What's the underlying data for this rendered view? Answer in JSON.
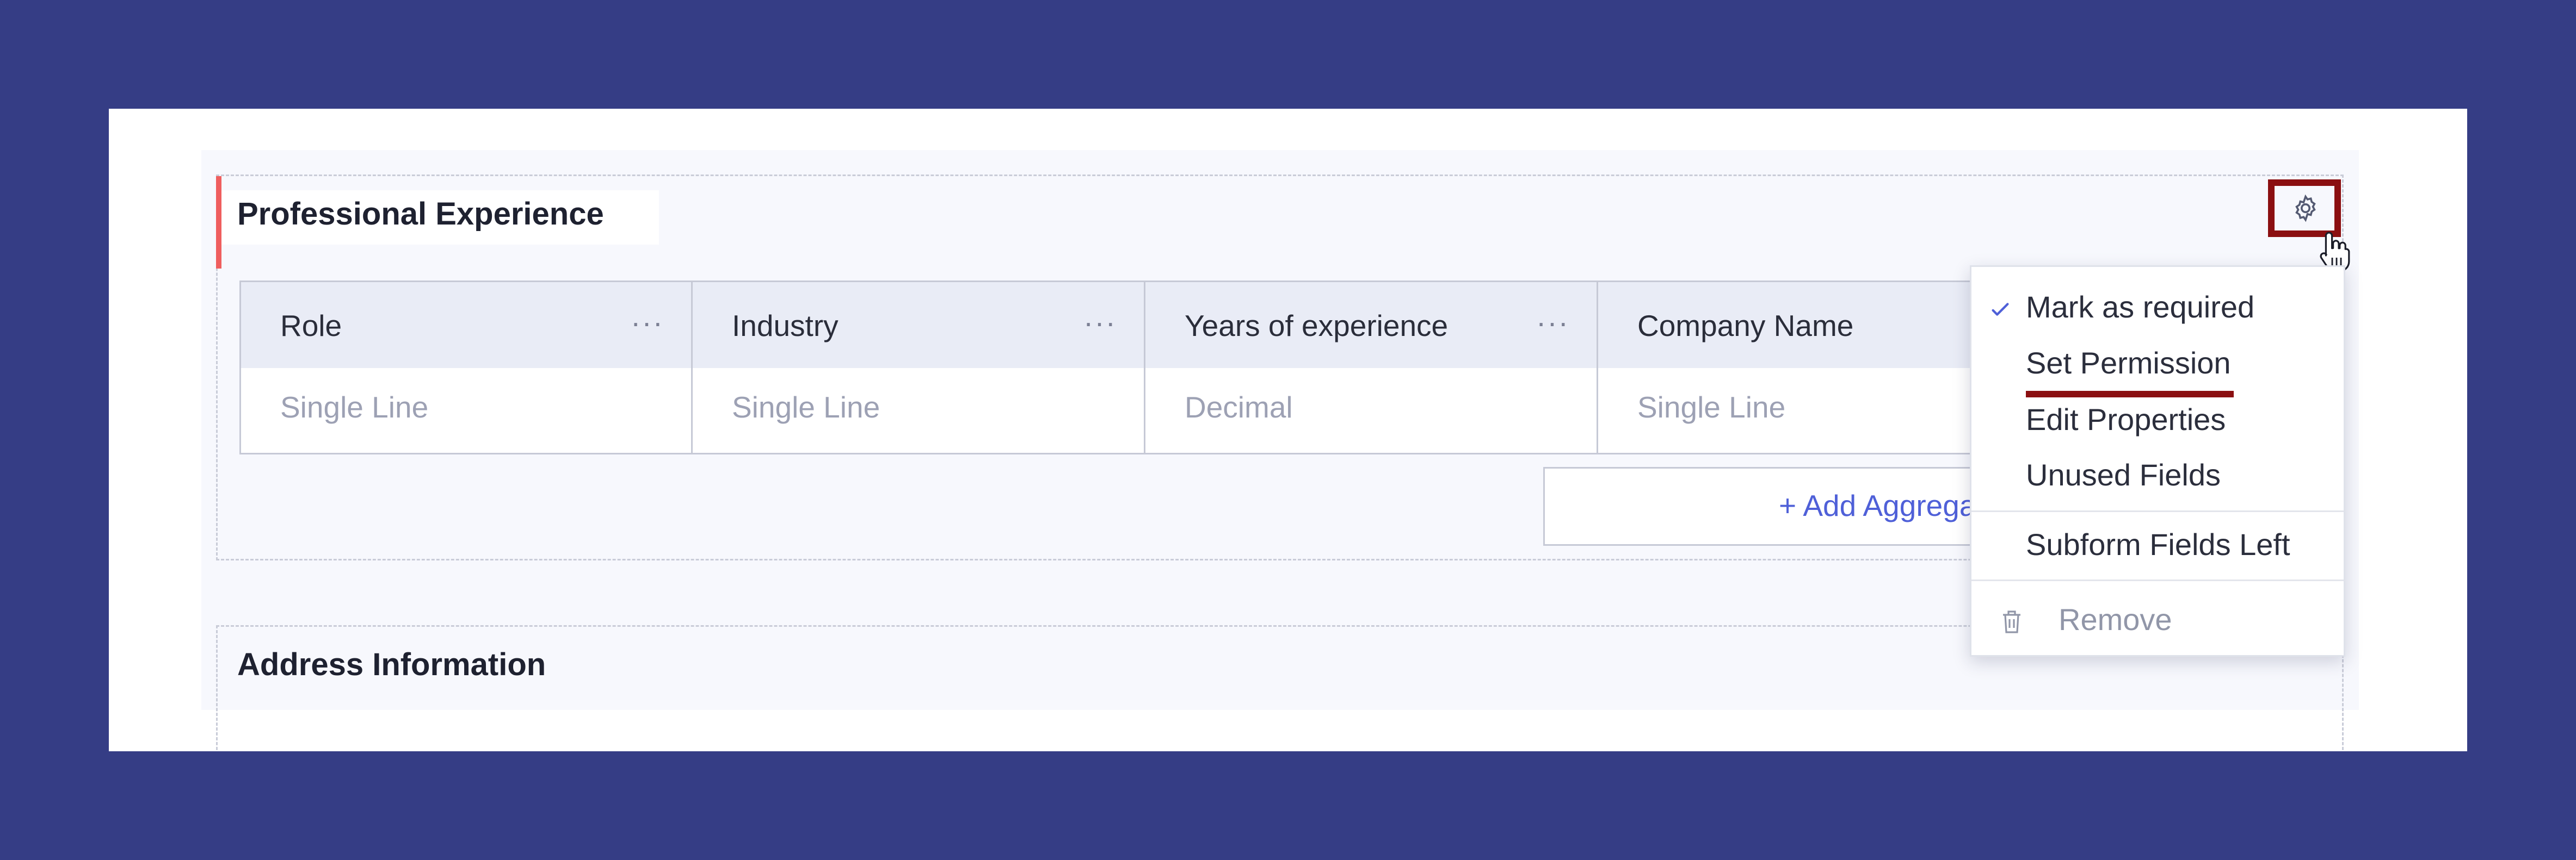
{
  "sections": [
    {
      "title": "Professional Experience",
      "columns": [
        {
          "label": "Role",
          "type": "Single Line"
        },
        {
          "label": "Industry",
          "type": "Single Line"
        },
        {
          "label": "Years of experience",
          "type": "Decimal"
        },
        {
          "label": "Company Name",
          "type": "Single Line"
        }
      ],
      "column_menu_glyph": "···",
      "aggregate_button": "+ Add Aggregate"
    },
    {
      "title": "Address Information"
    }
  ],
  "settings": {
    "icon": "gear-icon"
  },
  "context_menu": {
    "items": [
      {
        "label": "Mark as required",
        "checked": true
      },
      {
        "label": "Set Permission",
        "highlighted": true
      },
      {
        "label": "Edit Properties"
      },
      {
        "label": "Unused Fields"
      },
      {
        "label": "Subform Fields Left"
      },
      {
        "label": "Remove",
        "icon": "trash-icon",
        "muted": true
      }
    ]
  },
  "colors": {
    "background": "#353d85",
    "accent_bar": "#ef5e5e",
    "highlight": "#8b0f11",
    "link": "#4f60d8"
  }
}
